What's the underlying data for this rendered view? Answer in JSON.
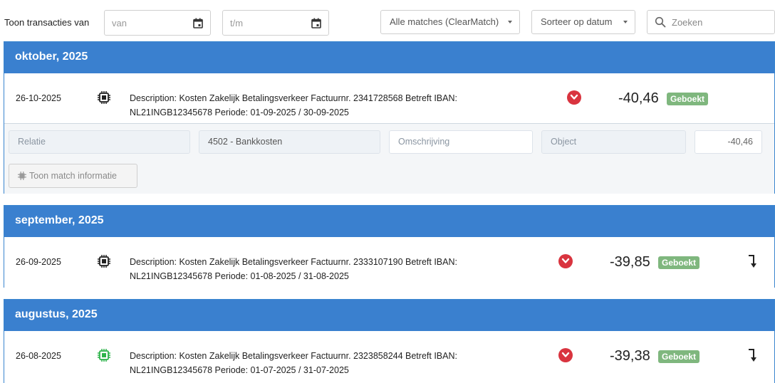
{
  "toolbar": {
    "label": "Toon transacties van",
    "from_placeholder": "van",
    "to_placeholder": "t/m",
    "match_filter": "Alle matches (ClearMatch)",
    "sort": "Sorteer op datum",
    "search_placeholder": "Zoeken"
  },
  "colors": {
    "header_blue": "#3a80cf",
    "badge_green": "#7fb77e",
    "toggle_red": "#d9343f",
    "chip_green": "#2db34a"
  },
  "months": [
    {
      "title": "oktober, 2025",
      "tx": {
        "date": "26-10-2025",
        "desc1": "Description: Kosten Zakelijk Betalingsverkeer Factuurnr. 2341728568 Betreft IBAN:",
        "desc2": "NL21INGB12345678 Periode: 01-09-2025 / 30-09-2025",
        "amount": "-40,46",
        "status": "Geboekt",
        "icon": "chip-icon"
      },
      "match": {
        "relatie": "Relatie",
        "grootboek": "4502 - Bankkosten",
        "omschrijving": "Omschrijving",
        "object": "Object",
        "bedrag": "-40,46",
        "button": "Toon match informatie"
      }
    },
    {
      "title": "september, 2025",
      "tx": {
        "date": "26-09-2025",
        "desc1": "Description: Kosten Zakelijk Betalingsverkeer Factuurnr. 2333107190 Betreft IBAN:",
        "desc2": "NL21INGB12345678 Periode: 01-08-2025 / 31-08-2025",
        "amount": "-39,85",
        "status": "Geboekt",
        "icon": "chip-icon"
      }
    },
    {
      "title": "augustus, 2025",
      "tx": {
        "date": "26-08-2025",
        "desc1": "Description: Kosten Zakelijk Betalingsverkeer Factuurnr. 2323858244 Betreft IBAN:",
        "desc2": "NL21INGB12345678 Periode: 01-07-2025 / 31-07-2025",
        "amount": "-39,38",
        "status": "Geboekt",
        "icon": "chip-icon-green"
      }
    }
  ]
}
